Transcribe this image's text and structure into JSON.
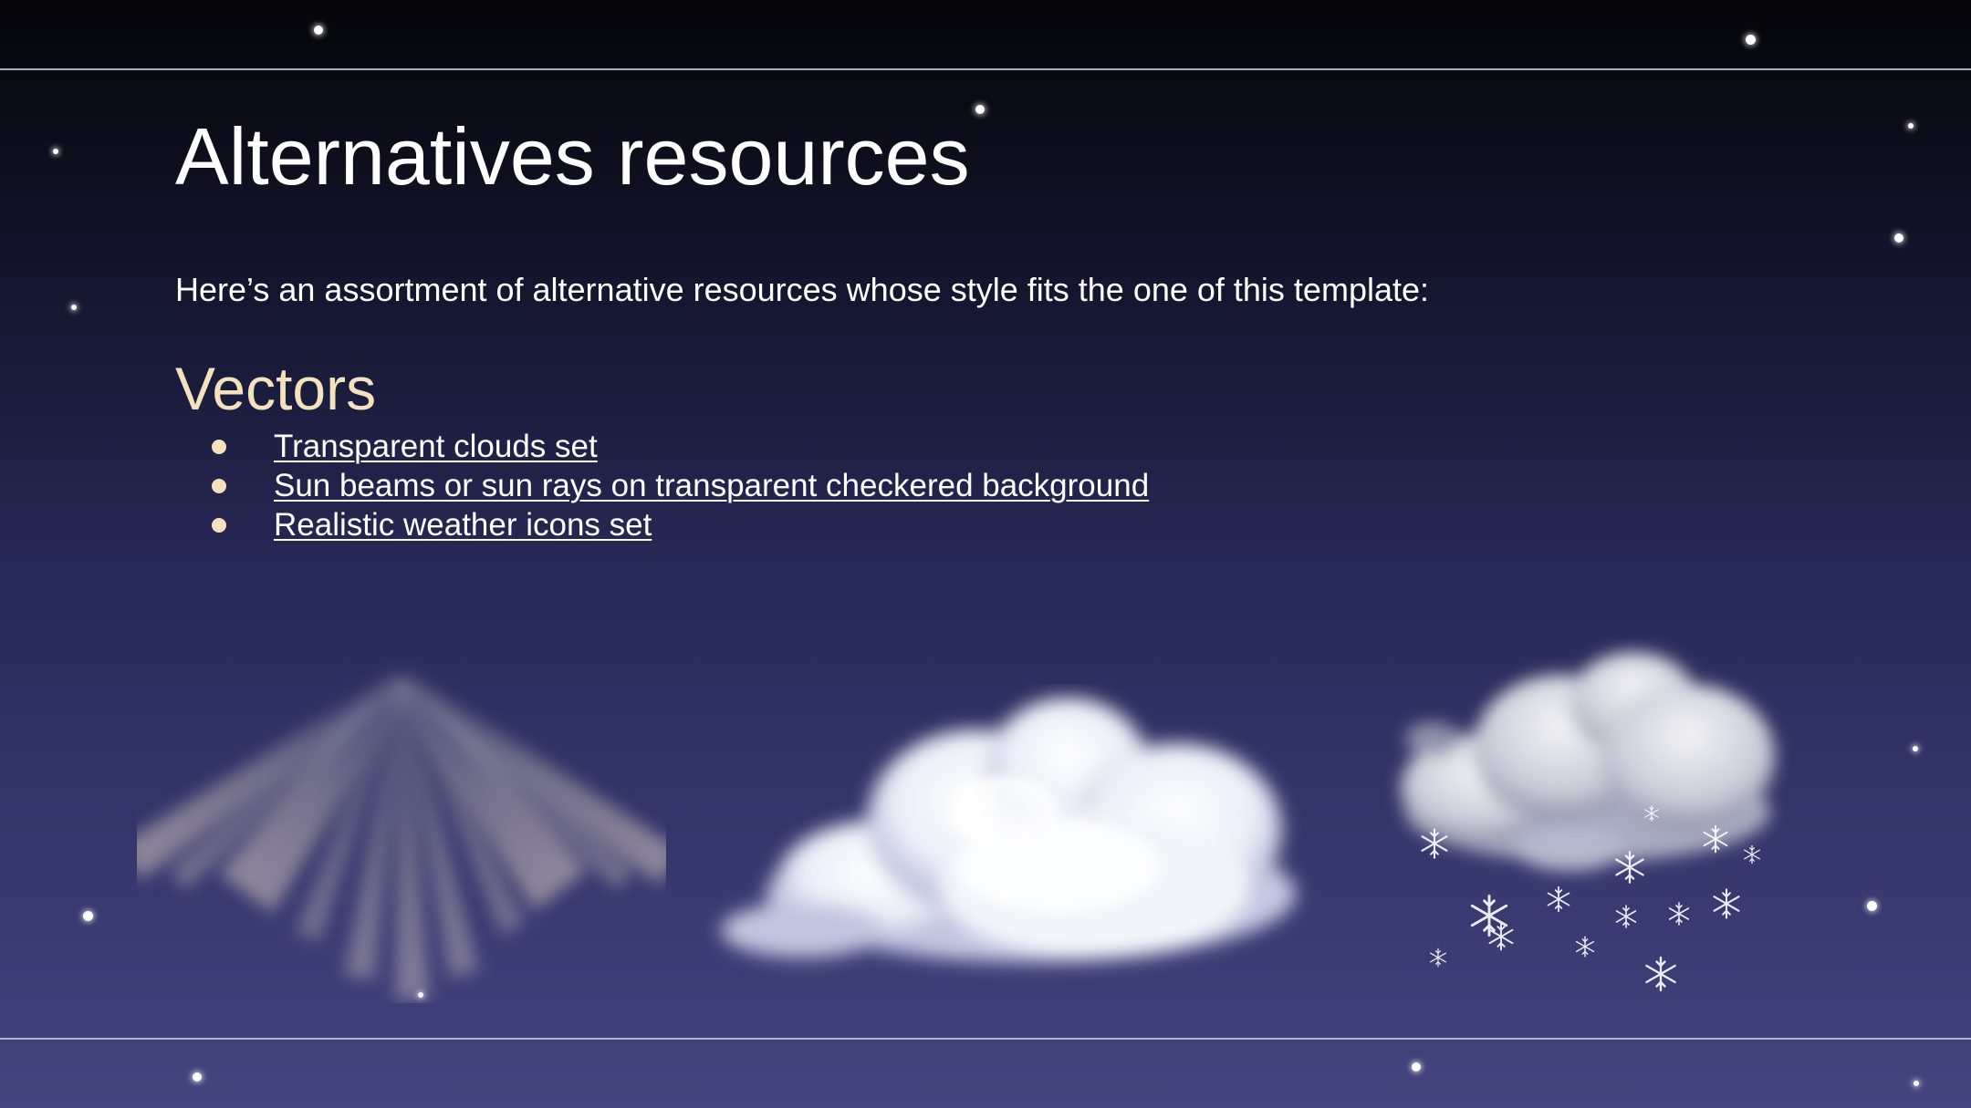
{
  "slide": {
    "title": "Alternatives resources",
    "intro": "Here’s an assortment of alternative resources whose style fits the one of this template:",
    "section_heading": "Vectors",
    "links": [
      {
        "label": "Transparent clouds set"
      },
      {
        "label": "Sun beams or sun rays on transparent checkered background"
      },
      {
        "label": "Realistic weather icons set"
      }
    ]
  },
  "illustrations": [
    {
      "name": "sun-rays-icon"
    },
    {
      "name": "cloud-icon"
    },
    {
      "name": "snow-cloud-icon"
    }
  ],
  "colors": {
    "background_top": "#050509",
    "background_bottom": "#43457e",
    "title": "#ffffff",
    "accent": "#f6e1bf",
    "divider": "#c9cbd6"
  }
}
